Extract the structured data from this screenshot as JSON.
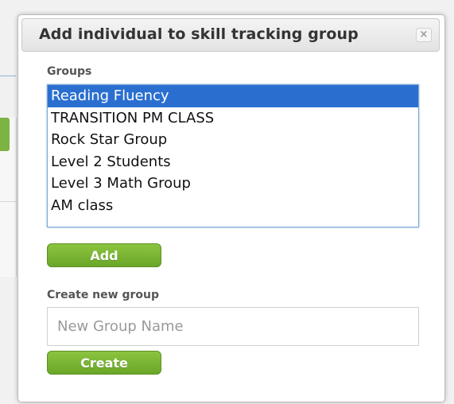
{
  "dialog": {
    "title": "Add individual to skill tracking group",
    "close_glyph": "×"
  },
  "groups": {
    "label": "Groups",
    "items": [
      {
        "label": "Reading Fluency",
        "selected": true
      },
      {
        "label": "TRANSITION PM CLASS",
        "selected": false
      },
      {
        "label": "Rock Star Group",
        "selected": false
      },
      {
        "label": "Level 2 Students",
        "selected": false
      },
      {
        "label": "Level 3 Math Group",
        "selected": false
      },
      {
        "label": "AM class",
        "selected": false
      }
    ],
    "add_label": "Add"
  },
  "create": {
    "label": "Create new group",
    "placeholder": "New Group Name",
    "value": "",
    "button_label": "Create"
  },
  "colors": {
    "selection": "#2a6fd0",
    "button_green": "#7cb342",
    "list_border": "#7aa7d8"
  },
  "icons": {
    "close": "close-icon"
  }
}
